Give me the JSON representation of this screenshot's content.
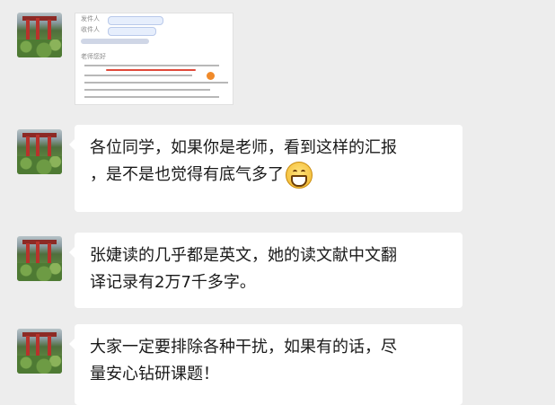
{
  "messages": [
    {
      "type": "image",
      "alt": ""
    },
    {
      "type": "text",
      "lines": [
        "各位同学，如果你是老师，看到这样的汇报",
        "，是不是也觉得有底气多了"
      ],
      "emoji": "grin-emoji"
    },
    {
      "type": "text",
      "lines": [
        "张婕读的几乎都是英文，她的读文献中文翻",
        "译记录有2万7千多字。"
      ]
    },
    {
      "type": "text",
      "lines": [
        "大家一定要排除各种干扰，如果有的话，尽",
        "量安心钻研课题！"
      ]
    }
  ],
  "shot": {
    "from_label": "发件人",
    "to_label": "收件人",
    "greeting": "老师您好"
  },
  "colors": {
    "background": "#ededed",
    "bubble": "#ffffff",
    "text": "#1a1a1a"
  }
}
